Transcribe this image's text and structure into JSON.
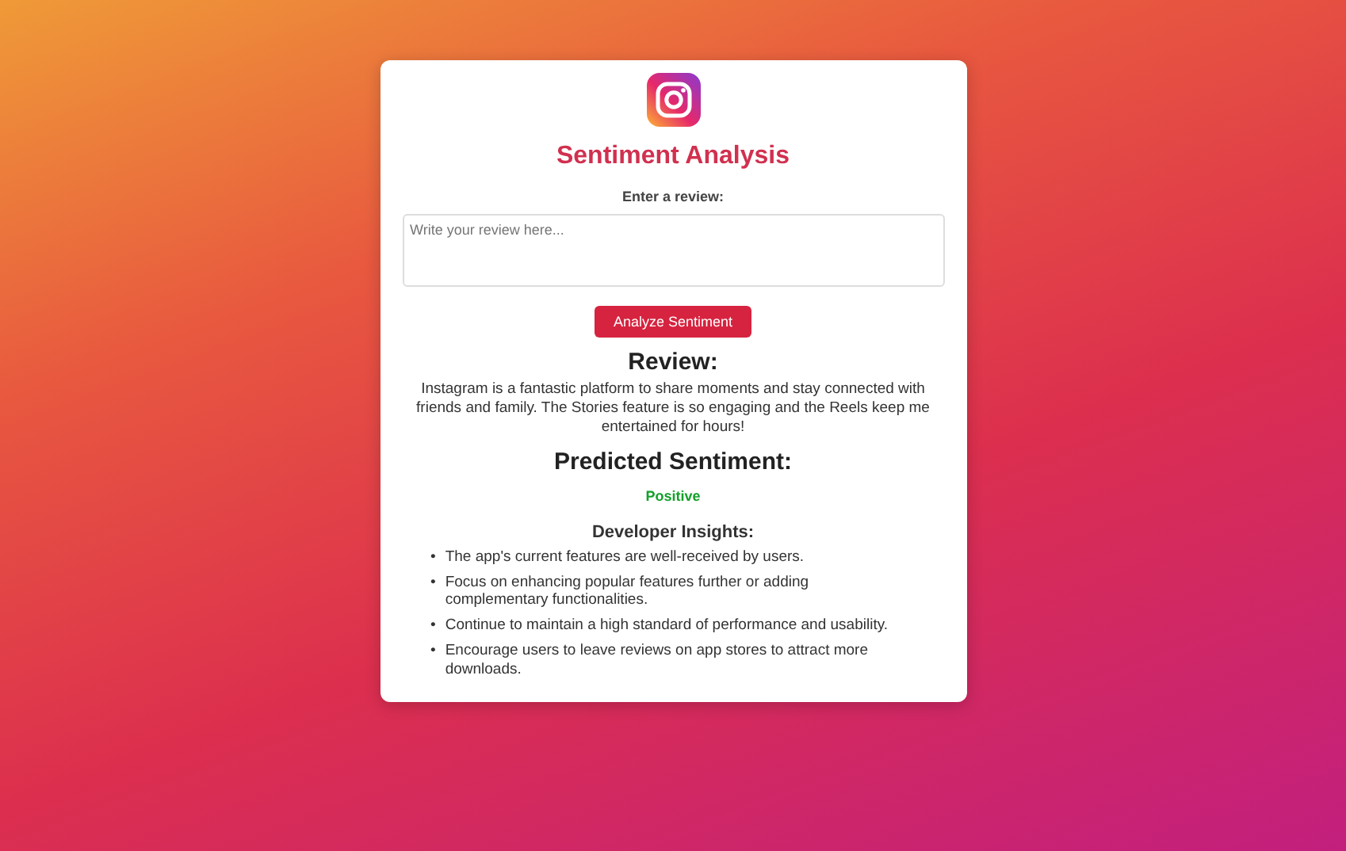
{
  "app": {
    "title": "Sentiment Analysis"
  },
  "form": {
    "label": "Enter a review:",
    "placeholder": "Write your review here...",
    "button": "Analyze Sentiment"
  },
  "review": {
    "heading": "Review:",
    "text": "Instagram is a fantastic platform to share moments and stay connected with friends and family. The Stories feature is so engaging and the Reels keep me entertained for hours!"
  },
  "prediction": {
    "heading": "Predicted Sentiment:",
    "value": "Positive"
  },
  "insights": {
    "heading": "Developer Insights:",
    "items": [
      {
        "bullet": "•",
        "text": "The app's current features are well-received by users."
      },
      {
        "bullet": "•",
        "text": "Focus on enhancing popular features further or adding complementary functionalities."
      },
      {
        "bullet": "•",
        "text": "Continue to maintain a high standard of performance and usability."
      },
      {
        "bullet": "•",
        "text": "Encourage users to leave reviews on app stores to attract more downloads."
      }
    ]
  }
}
